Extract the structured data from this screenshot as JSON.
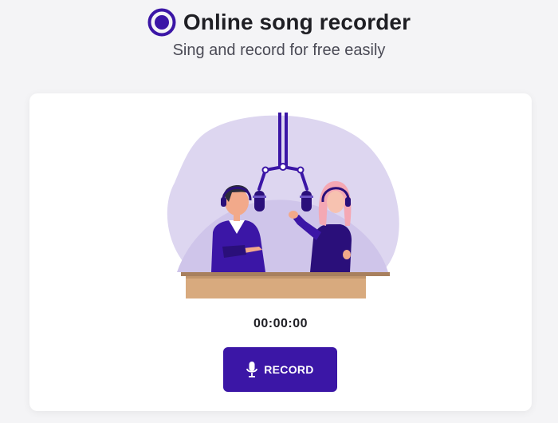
{
  "header": {
    "logo_icon": "record-circle-icon",
    "title": "Online song recorder",
    "subtitle": "Sing and record for free easily"
  },
  "recorder": {
    "illustration_icon": "podcast-studio-illustration",
    "timer": "00:00:00",
    "record_button": {
      "icon": "microphone-icon",
      "label": "RECORD"
    }
  },
  "colors": {
    "accent": "#3b16a6",
    "background": "#f4f4f6",
    "card": "#ffffff",
    "blob": "#ddd6f0"
  }
}
